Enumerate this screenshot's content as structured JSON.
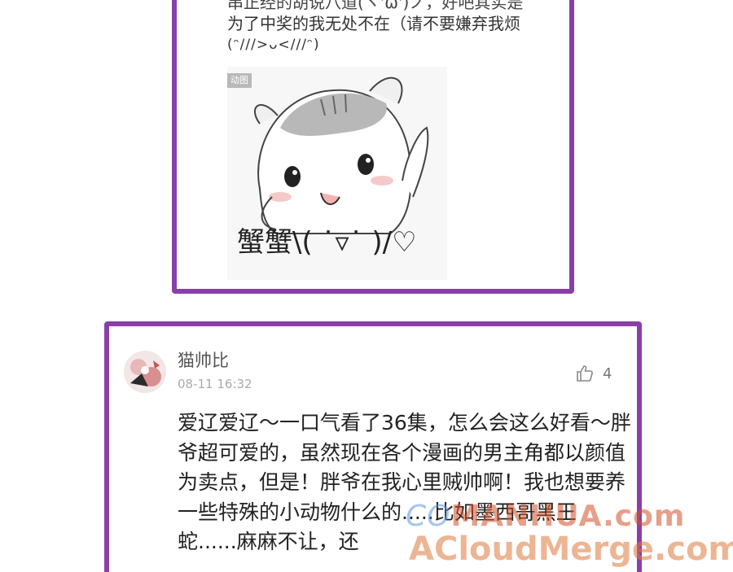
{
  "card1": {
    "text_line_partial": "串正经的胡说八道(ヽ'ω')ノ，好吧其实是",
    "text_line_1": "为了中奖的我无处不在（请不要嫌弃我烦",
    "text_line_2": "(ᵔ///>ᴗ<///ᵔ)",
    "gif_badge": "动图",
    "sticker_caption": "蟹蟹\\( ˙▿˙ )/♡"
  },
  "comment": {
    "username": "猫帅比",
    "timestamp": "08-11 16:32",
    "like_count": "4",
    "like_icon": "thumbs-up-icon",
    "body": "爱辽爱辽～一口气看了36集，怎么会这么好看～胖爷超可爱的，虽然现在各个漫画的男主角都以颜值为卖点，但是！胖爷在我心里贼帅啊！我也想要养一些特殊的小动物什么的.....比如墨西哥黑王蛇......麻麻不让，还"
  },
  "watermark": {
    "line1_prefix": "CO",
    "line1": "MANHUA.com",
    "line2": "ACloudMerge.com"
  },
  "colors": {
    "frame": "#8a3fa8",
    "text": "#222222",
    "meta": "#aaaaaa"
  }
}
